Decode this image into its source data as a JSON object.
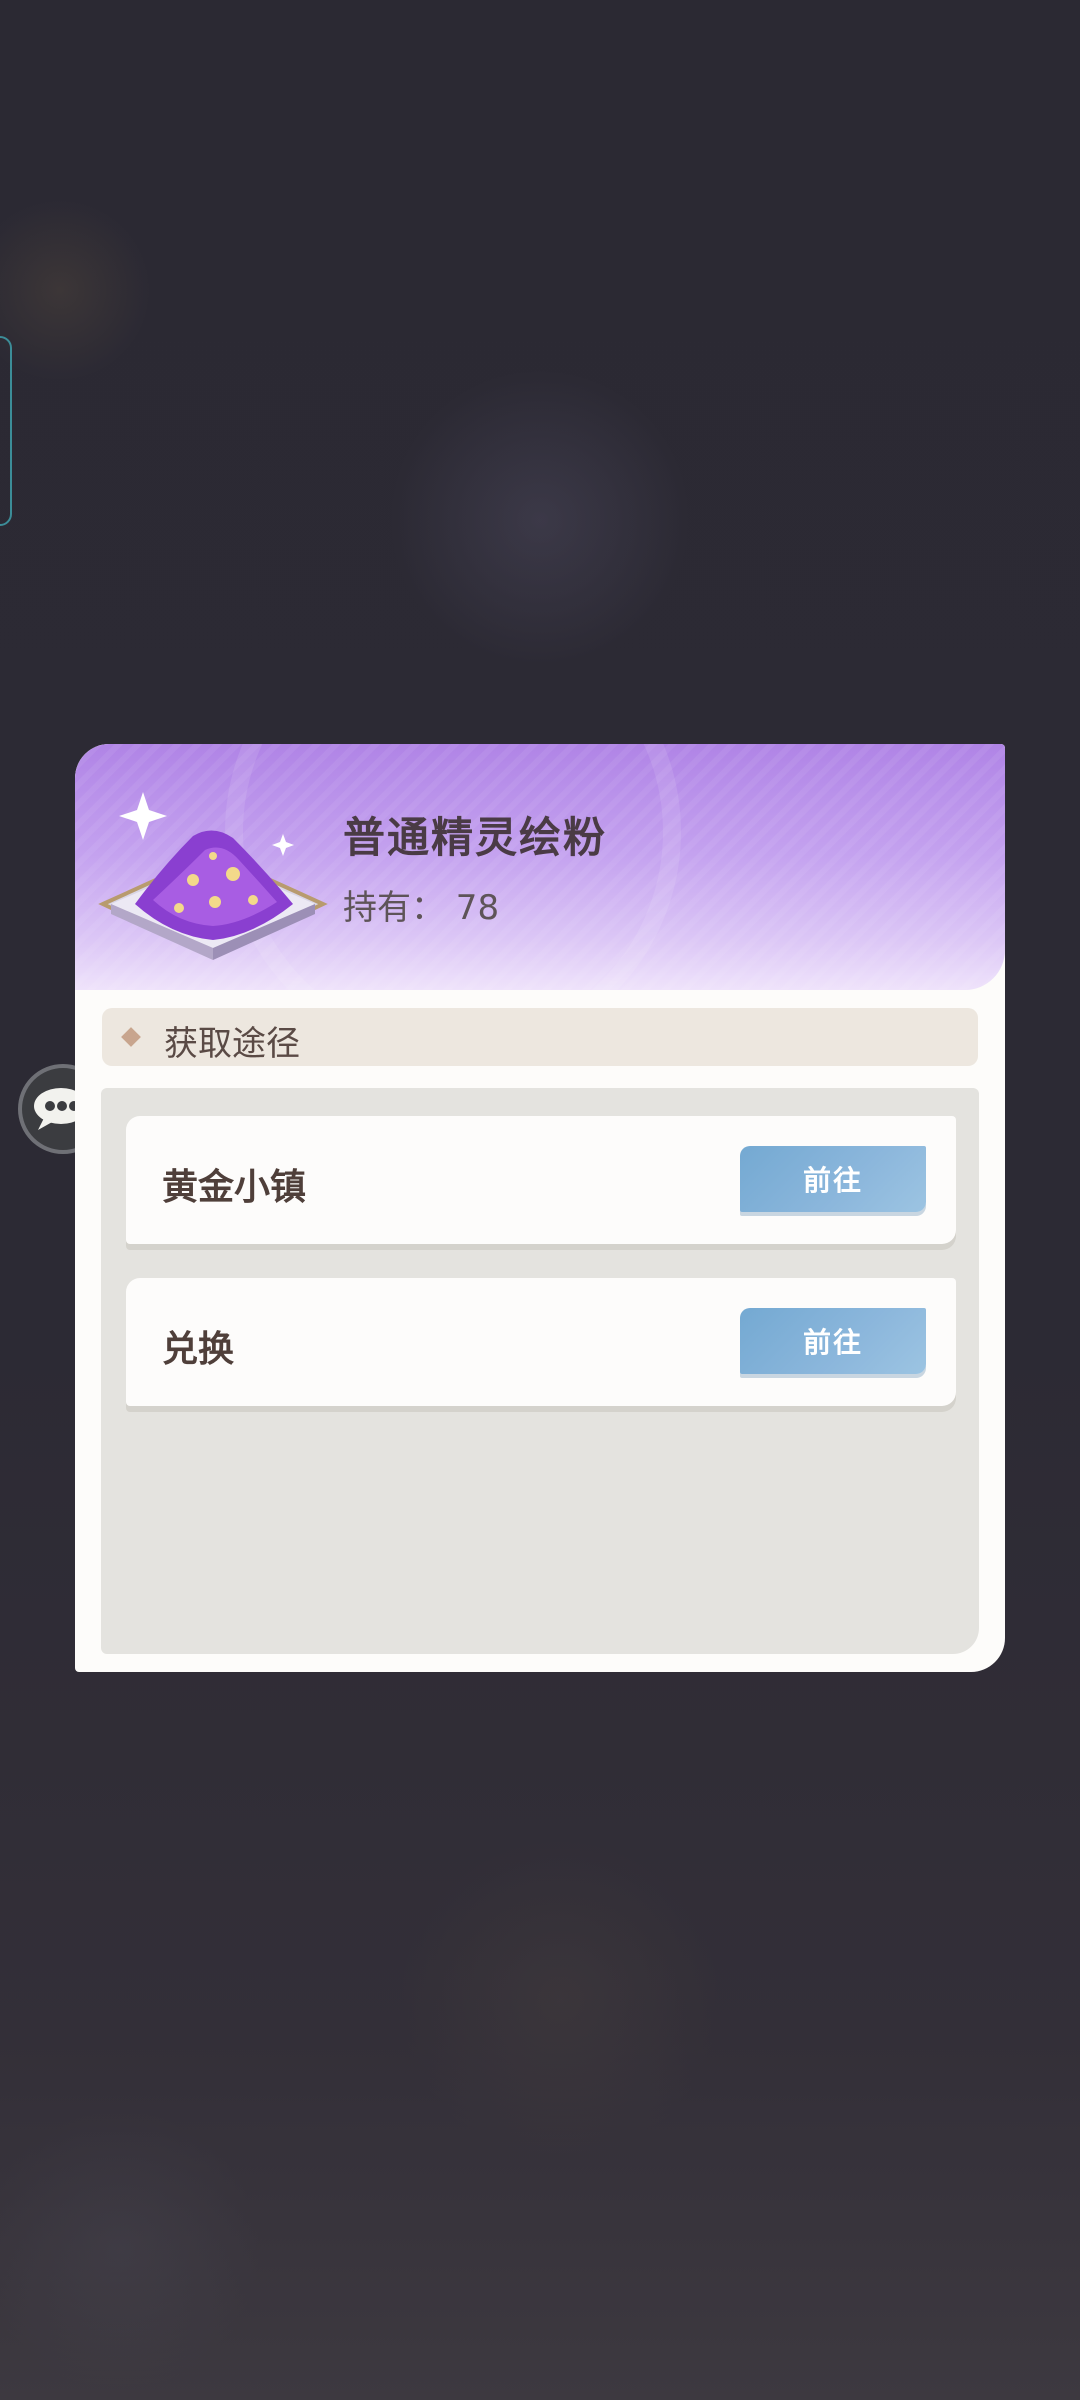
{
  "item": {
    "name": "普通精灵绘粉",
    "owned_text": "持有：  78"
  },
  "section": {
    "title": "获取途径"
  },
  "sources": [
    {
      "name": "黄金小镇",
      "button": "前往"
    },
    {
      "name": "兑换",
      "button": "前往"
    }
  ],
  "colors": {
    "header_purple": "#b084e6",
    "button_blue": "#7fb0d8",
    "background": "#2b2831"
  },
  "icons": {
    "item": "sparkle-powder-icon",
    "floating": "chat-bubble-icon"
  }
}
